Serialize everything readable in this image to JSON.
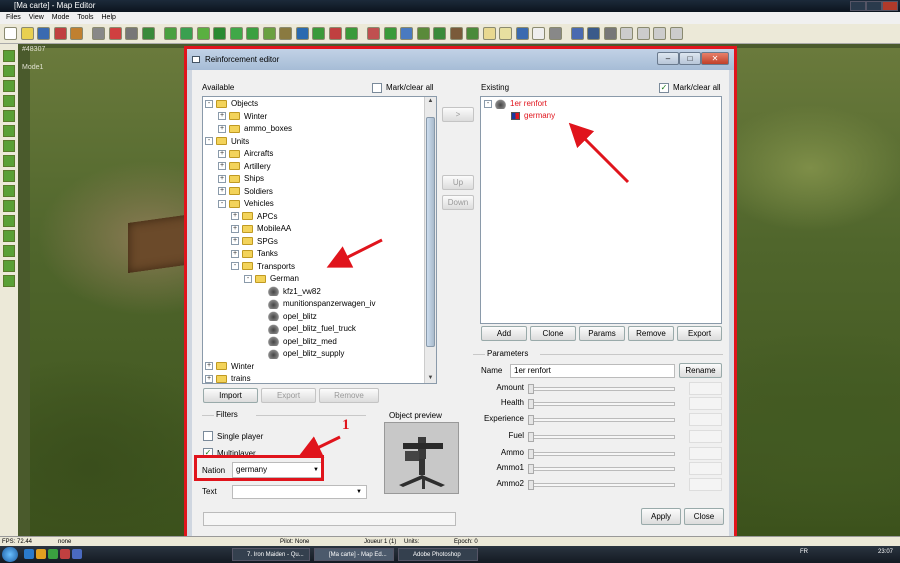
{
  "app": {
    "title": "[Ma carte] - Map Editor",
    "overlay_id": "#48307",
    "overlay_mode": "Mode1"
  },
  "menu": [
    "Files",
    "View",
    "Mode",
    "Tools",
    "Help"
  ],
  "status": {
    "fps": "FPS: 72.44",
    "none1": "none",
    "pilot": "Pilot: None",
    "joueur": "Joueur 1 (1)",
    "units": "Units:",
    "epoch": "Epoch: 0"
  },
  "taskbar": {
    "tasks": [
      "7. Iron Maiden - Qu...",
      "[Ma carte] - Map Ed...",
      "Adobe Photoshop"
    ],
    "lang": "FR",
    "clock": "23:07"
  },
  "dialog": {
    "title": "Reinforcement editor",
    "available_label": "Available",
    "mark_clear_all": "Mark/clear all",
    "existing_label": "Existing",
    "existing_mark_clear_all": "Mark/clear all",
    "move_right": ">",
    "up": "Up",
    "down": "Down",
    "tree": [
      {
        "label": "Objects",
        "level": 1,
        "expander": "-",
        "icon": "folder"
      },
      {
        "label": "Winter",
        "level": 2,
        "expander": "+",
        "icon": "folder"
      },
      {
        "label": "ammo_boxes",
        "level": 2,
        "expander": "+",
        "icon": "folder"
      },
      {
        "label": "Units",
        "level": 1,
        "expander": "-",
        "icon": "folder"
      },
      {
        "label": "Aircrafts",
        "level": 2,
        "expander": "+",
        "icon": "folder"
      },
      {
        "label": "Artillery",
        "level": 2,
        "expander": "+",
        "icon": "folder"
      },
      {
        "label": "Ships",
        "level": 2,
        "expander": "+",
        "icon": "folder"
      },
      {
        "label": "Soldiers",
        "level": 2,
        "expander": "+",
        "icon": "folder"
      },
      {
        "label": "Vehicles",
        "level": 2,
        "expander": "-",
        "icon": "folder"
      },
      {
        "label": "APCs",
        "level": 3,
        "expander": "+",
        "icon": "folder"
      },
      {
        "label": "MobileAA",
        "level": 3,
        "expander": "+",
        "icon": "folder"
      },
      {
        "label": "SPGs",
        "level": 3,
        "expander": "+",
        "icon": "folder"
      },
      {
        "label": "Tanks",
        "level": 3,
        "expander": "+",
        "icon": "folder"
      },
      {
        "label": "Transports",
        "level": 3,
        "expander": "-",
        "icon": "folder"
      },
      {
        "label": "German",
        "level": 4,
        "expander": "-",
        "icon": "folder"
      },
      {
        "label": "kfz1_vw82",
        "level": 5,
        "expander": "",
        "icon": "gun"
      },
      {
        "label": "munitionspanzerwagen_iv",
        "level": 5,
        "expander": "",
        "icon": "gun"
      },
      {
        "label": "opel_blitz",
        "level": 5,
        "expander": "",
        "icon": "gun"
      },
      {
        "label": "opel_blitz_fuel_truck",
        "level": 5,
        "expander": "",
        "icon": "gun"
      },
      {
        "label": "opel_blitz_med",
        "level": 5,
        "expander": "",
        "icon": "gun"
      },
      {
        "label": "opel_blitz_supply",
        "level": 5,
        "expander": "",
        "icon": "gun"
      },
      {
        "label": "Winter",
        "level": 1,
        "expander": "+",
        "icon": "folder"
      },
      {
        "label": "trains",
        "level": 1,
        "expander": "+",
        "icon": "folder"
      }
    ],
    "existing_tree": [
      {
        "label": "1er renfort",
        "color": "#e0141c"
      },
      {
        "label": "germany",
        "color": "#e0141c"
      }
    ],
    "left_buttons": {
      "import": "Import",
      "export": "Export",
      "remove": "Remove"
    },
    "filters_label": "Filters",
    "single_player": "Single player",
    "multiplayer": "Multiplayer",
    "nation_label": "Nation",
    "nation_value": "germany",
    "text_label": "Text",
    "object_preview": "Object preview",
    "right_buttons": {
      "add": "Add",
      "clone": "Clone",
      "params": "Params",
      "remove": "Remove",
      "export": "Export"
    },
    "parameters_label": "Parameters",
    "name_label": "Name",
    "name_value": "1er renfort",
    "rename": "Rename",
    "params": [
      "Amount",
      "Health",
      "Experience",
      "Fuel",
      "Ammo",
      "Ammo1",
      "Ammo2"
    ],
    "apply": "Apply",
    "close": "Close",
    "annotation_number": "1"
  },
  "colors": {
    "accent_red": "#e0141c"
  }
}
